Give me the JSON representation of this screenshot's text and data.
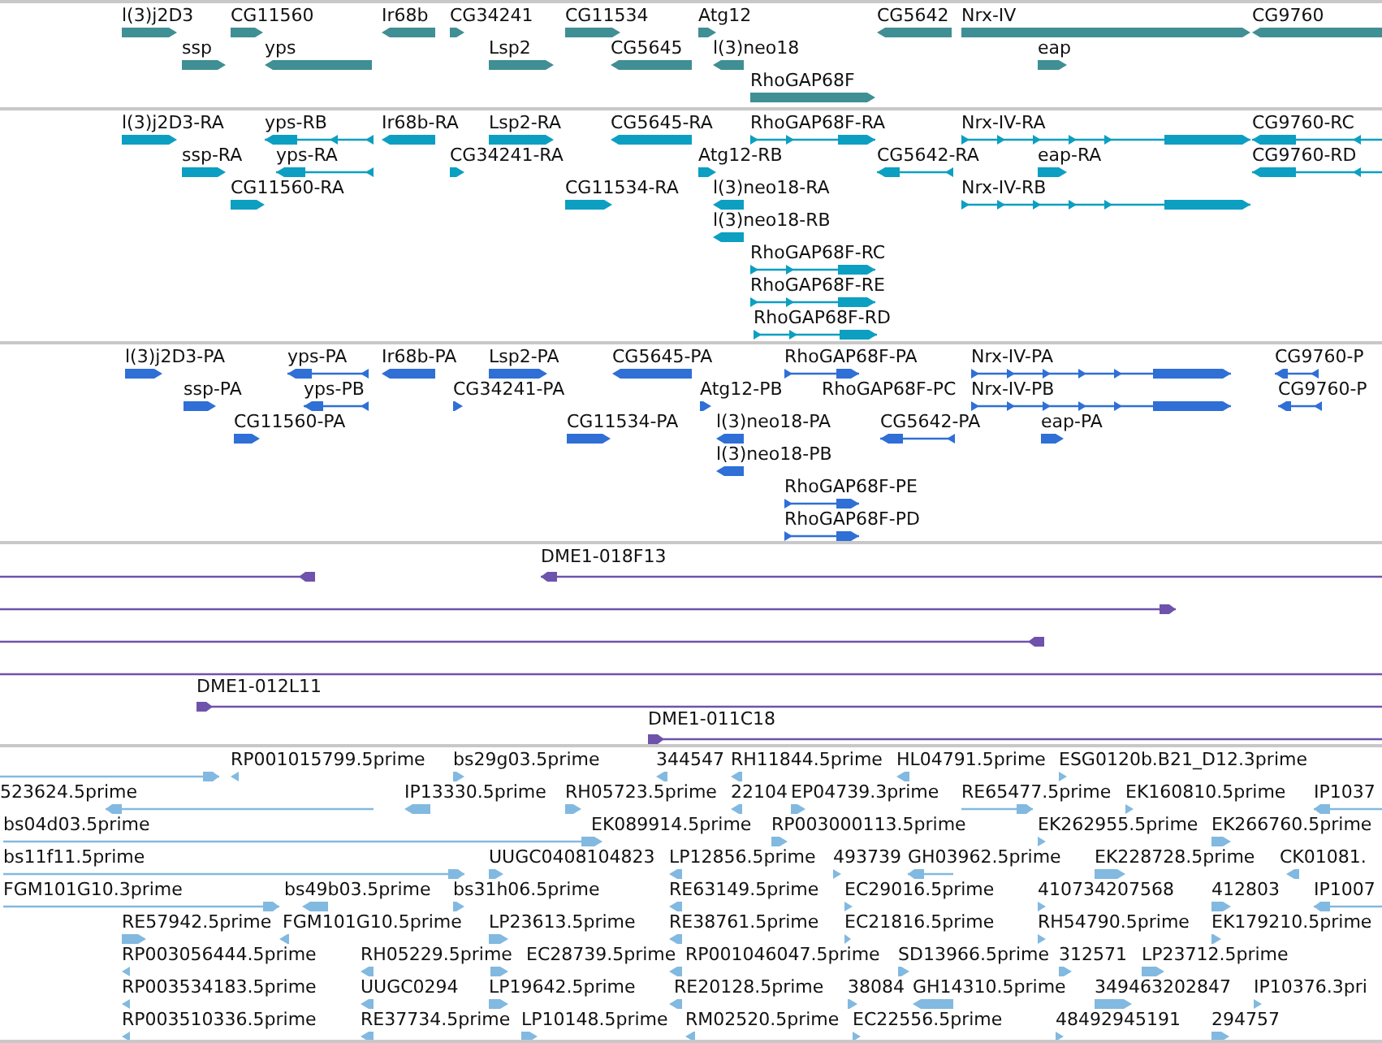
{
  "tracks": [
    {
      "kind": "gene",
      "features": [
        {
          "label": "l(3)j2D3",
          "reverse": false
        },
        {
          "label": "CG11560",
          "reverse": false
        },
        {
          "label": "Ir68b",
          "reverse": true
        },
        {
          "label": "CG34241",
          "reverse": false
        },
        {
          "label": "CG11534",
          "reverse": false
        },
        {
          "label": "Atg12",
          "reverse": false
        },
        {
          "label": "CG5642",
          "reverse": true
        },
        {
          "label": "Nrx-IV",
          "reverse": false
        },
        {
          "label": "CG9760",
          "reverse": true
        },
        {
          "label": "ssp",
          "reverse": false
        },
        {
          "label": "yps",
          "reverse": true
        },
        {
          "label": "Lsp2",
          "reverse": false
        },
        {
          "label": "CG5645",
          "reverse": true
        },
        {
          "label": "l(3)neo18",
          "reverse": true
        },
        {
          "label": "eap",
          "reverse": false
        },
        {
          "label": "RhoGAP68F",
          "reverse": false
        }
      ]
    },
    {
      "kind": "transcript",
      "features": [
        {
          "label": "l(3)j2D3-RA",
          "reverse": false
        },
        {
          "label": "yps-RB",
          "reverse": true
        },
        {
          "label": "Ir68b-RA",
          "reverse": true
        },
        {
          "label": "Lsp2-RA",
          "reverse": false
        },
        {
          "label": "CG5645-RA",
          "reverse": true
        },
        {
          "label": "RhoGAP68F-RA",
          "reverse": false
        },
        {
          "label": "Nrx-IV-RA",
          "reverse": false
        },
        {
          "label": "CG9760-RC",
          "reverse": true
        },
        {
          "label": "ssp-RA",
          "reverse": false
        },
        {
          "label": "yps-RA",
          "reverse": true
        },
        {
          "label": "CG34241-RA",
          "reverse": false
        },
        {
          "label": "Atg12-RB",
          "reverse": false
        },
        {
          "label": "CG5642-RA",
          "reverse": true
        },
        {
          "label": "eap-RA",
          "reverse": false
        },
        {
          "label": "CG9760-RD",
          "reverse": true
        },
        {
          "label": "CG11560-RA",
          "reverse": false
        },
        {
          "label": "CG11534-RA",
          "reverse": false
        },
        {
          "label": "l(3)neo18-RA",
          "reverse": true
        },
        {
          "label": "Nrx-IV-RB",
          "reverse": false
        },
        {
          "label": "l(3)neo18-RB",
          "reverse": true
        },
        {
          "label": "RhoGAP68F-RC",
          "reverse": false
        },
        {
          "label": "RhoGAP68F-RE",
          "reverse": false
        },
        {
          "label": "RhoGAP68F-RD",
          "reverse": false
        }
      ]
    },
    {
      "kind": "protein",
      "features": [
        {
          "label": "l(3)j2D3-PA",
          "reverse": false
        },
        {
          "label": "yps-PA",
          "reverse": true
        },
        {
          "label": "Ir68b-PA",
          "reverse": true
        },
        {
          "label": "Lsp2-PA",
          "reverse": false
        },
        {
          "label": "CG5645-PA",
          "reverse": true
        },
        {
          "label": "RhoGAP68F-PA",
          "reverse": false
        },
        {
          "label": "Nrx-IV-PA",
          "reverse": false
        },
        {
          "label": "CG9760-P",
          "reverse": true
        },
        {
          "label": "ssp-PA",
          "reverse": false
        },
        {
          "label": "yps-PB",
          "reverse": true
        },
        {
          "label": "CG34241-PA",
          "reverse": false
        },
        {
          "label": "Atg12-PB",
          "reverse": false
        },
        {
          "label": "RhoGAP68F-PC"
        },
        {
          "label": "Nrx-IV-PB",
          "reverse": false
        },
        {
          "label": "CG9760-P",
          "reverse": true
        },
        {
          "label": "CG11560-PA",
          "reverse": false
        },
        {
          "label": "CG11534-PA",
          "reverse": false
        },
        {
          "label": "l(3)neo18-PA",
          "reverse": true
        },
        {
          "label": "CG5642-PA",
          "reverse": true
        },
        {
          "label": "eap-PA",
          "reverse": false
        },
        {
          "label": "l(3)neo18-PB",
          "reverse": true
        },
        {
          "label": "RhoGAP68F-PE",
          "reverse": false
        },
        {
          "label": "RhoGAP68F-PD",
          "reverse": false
        }
      ]
    },
    {
      "kind": "clone",
      "features": [
        {
          "kind": "clone",
          "reverse": true
        },
        {
          "kind": "clone",
          "label": "DME1-018F13",
          "reverse": true
        },
        {
          "kind": "clone",
          "reverse": false
        },
        {
          "kind": "clone",
          "reverse": true
        },
        {
          "kind": "span"
        },
        {
          "kind": "clone",
          "label": "DME1-012L11",
          "reverse": false
        },
        {
          "kind": "clone",
          "label": "DME1-011C18",
          "reverse": false
        }
      ]
    },
    {
      "kind": "est",
      "features": [
        {
          "reverse": false
        },
        {
          "label": "RP001015799.5prime",
          "reverse": true
        },
        {
          "label": "bs29g03.5prime",
          "reverse": false
        },
        {
          "label": "344547",
          "reverse": true
        },
        {
          "label": "RH11844.5prime",
          "reverse": true
        },
        {
          "label": "HL04791.5prime",
          "reverse": true
        },
        {
          "label": "ESG0120b.B21_D12.3prime",
          "reverse": false
        },
        {
          "label": "523624.5prime",
          "reverse": true
        },
        {
          "label": "IP13330.5prime",
          "reverse": true
        },
        {
          "label": "RH05723.5prime",
          "reverse": false
        },
        {
          "label": "22104",
          "reverse": true
        },
        {
          "label": "EP04739.3prime",
          "reverse": false
        },
        {
          "label": "RE65477.5prime",
          "reverse": false
        },
        {
          "label": "EK160810.5prime",
          "reverse": false
        },
        {
          "label": "IP1037",
          "reverse": true
        },
        {
          "label": "bs04d03.5prime",
          "reverse": false
        },
        {
          "label": "EK089914.5prime",
          "reverse": false
        },
        {
          "label": "RP003000113.5prime",
          "reverse": false
        },
        {
          "label": "EK262955.5prime",
          "reverse": false
        },
        {
          "label": "EK266760.5prime",
          "reverse": false
        },
        {
          "label": "bs11f11.5prime",
          "reverse": false
        },
        {
          "label": "UUGC0408104823",
          "reverse": false
        },
        {
          "label": "LP12856.5prime",
          "reverse": true
        },
        {
          "label": "493739",
          "reverse": false
        },
        {
          "label": "GH03962.5prime",
          "reverse": true
        },
        {
          "label": "EK228728.5prime",
          "reverse": false
        },
        {
          "label": "CK01081.",
          "reverse": true
        },
        {
          "label": "FGM101G10.3prime",
          "reverse": false
        },
        {
          "label": "bs49b03.5prime",
          "reverse": true
        },
        {
          "label": "bs31h06.5prime",
          "reverse": false
        },
        {
          "label": "RE63149.5prime",
          "reverse": true
        },
        {
          "label": "EC29016.5prime",
          "reverse": false
        },
        {
          "label": "410734207568",
          "reverse": false
        },
        {
          "label": "412803",
          "reverse": false
        },
        {
          "label": "IP1007",
          "reverse": true
        },
        {
          "label": "RE57942.5prime",
          "reverse": false
        },
        {
          "label": "FGM101G10.5prime",
          "reverse": true
        },
        {
          "label": "LP23613.5prime",
          "reverse": false
        },
        {
          "label": "RE38761.5prime",
          "reverse": true
        },
        {
          "label": "EC21816.5prime",
          "reverse": false
        },
        {
          "label": "RH54790.5prime",
          "reverse": false
        },
        {
          "label": "EK179210.5prime",
          "reverse": false
        },
        {
          "label": "RP003056444.5prime",
          "reverse": true
        },
        {
          "label": "RH05229.5prime",
          "reverse": true
        },
        {
          "label": "EC28739.5prime",
          "reverse": false
        },
        {
          "label": "RP001046047.5prime",
          "reverse": true
        },
        {
          "label": "SD13966.5prime",
          "reverse": false
        },
        {
          "label": "312571",
          "reverse": false
        },
        {
          "label": "LP23712.5prime",
          "reverse": false
        },
        {
          "label": "RP003534183.5prime",
          "reverse": true
        },
        {
          "label": "UUGC0294",
          "reverse": true
        },
        {
          "label": "LP19642.5prime",
          "reverse": false
        },
        {
          "label": "RE20128.5prime",
          "reverse": true
        },
        {
          "label": "38084",
          "reverse": false
        },
        {
          "label": "GH14310.5prime",
          "reverse": true
        },
        {
          "label": "349463202847",
          "reverse": false
        },
        {
          "label": "IP10376.3pri",
          "reverse": false
        },
        {
          "label": "RP003510336.5prime",
          "reverse": true
        },
        {
          "label": "RE37734.5prime",
          "reverse": true
        },
        {
          "label": "LP10148.5prime",
          "reverse": false
        },
        {
          "label": "RM02520.5prime",
          "reverse": true
        },
        {
          "label": "EC22556.5prime",
          "reverse": false
        },
        {
          "label": "48492945191",
          "reverse": false
        },
        {
          "label": "294757",
          "reverse": false
        }
      ]
    }
  ]
}
